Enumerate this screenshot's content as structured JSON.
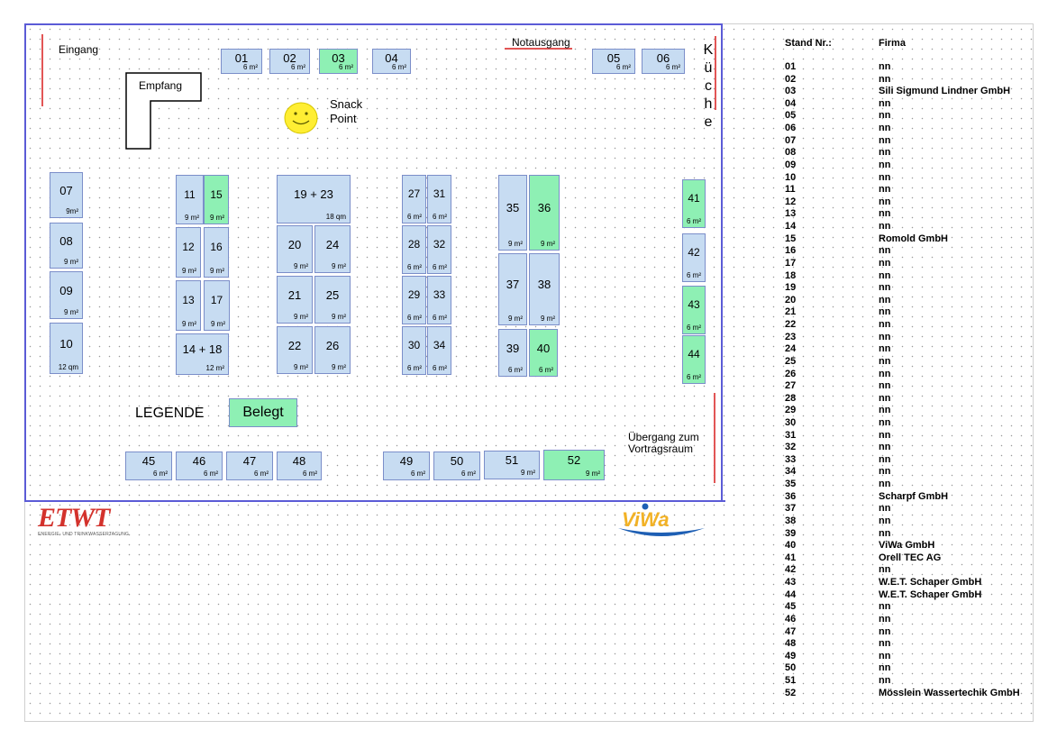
{
  "labels": {
    "entrance": "Eingang",
    "reception": "Empfang",
    "emergency_exit": "Notausgang",
    "snack_line1": "Snack",
    "snack_line2": "Point",
    "kitchen_letters": [
      "K",
      "ü",
      "c",
      "h",
      "e"
    ],
    "legend": "LEGENDE",
    "legend_occupied": "Belegt",
    "transition_line1": "Übergang zum",
    "transition_line2": "Vortragsraum"
  },
  "colors": {
    "stand_free": "#c7dcf2",
    "stand_occupied": "#8ef0b4",
    "hall_border": "#5b5bd6",
    "exit_line": "#e25555"
  },
  "stands": [
    {
      "num": "01",
      "area": "6 m²",
      "occupied": false
    },
    {
      "num": "02",
      "area": "6 m²",
      "occupied": false
    },
    {
      "num": "03",
      "area": "6 m²",
      "occupied": true
    },
    {
      "num": "04",
      "area": "6 m²",
      "occupied": false
    },
    {
      "num": "05",
      "area": "6 m²",
      "occupied": false
    },
    {
      "num": "06",
      "area": "6 m²",
      "occupied": false
    },
    {
      "num": "07",
      "area": "9m²",
      "occupied": false
    },
    {
      "num": "08",
      "area": "9 m²",
      "occupied": false
    },
    {
      "num": "09",
      "area": "9 m²",
      "occupied": false
    },
    {
      "num": "10",
      "area": "12 qm",
      "occupied": false
    },
    {
      "num": "11",
      "area": "9 m²",
      "occupied": false
    },
    {
      "num": "15",
      "area": "9 m²",
      "occupied": true
    },
    {
      "num": "12",
      "area": "9 m²",
      "occupied": false
    },
    {
      "num": "16",
      "area": "9 m²",
      "occupied": false
    },
    {
      "num": "13",
      "area": "9 m²",
      "occupied": false
    },
    {
      "num": "17",
      "area": "9 m²",
      "occupied": false
    },
    {
      "num": "14 + 18",
      "area": "12 m²",
      "occupied": false
    },
    {
      "num": "19  +  23",
      "area": "18 qm",
      "occupied": false
    },
    {
      "num": "20",
      "area": "9 m²",
      "occupied": false
    },
    {
      "num": "24",
      "area": "9 m²",
      "occupied": false
    },
    {
      "num": "21",
      "area": "9 m²",
      "occupied": false
    },
    {
      "num": "25",
      "area": "9 m²",
      "occupied": false
    },
    {
      "num": "22",
      "area": "9 m²",
      "occupied": false
    },
    {
      "num": "26",
      "area": "9 m²",
      "occupied": false
    },
    {
      "num": "27",
      "area": "6 m²",
      "occupied": false
    },
    {
      "num": "31",
      "area": "6 m²",
      "occupied": false
    },
    {
      "num": "28",
      "area": "6 m²",
      "occupied": false
    },
    {
      "num": "32",
      "area": "6 m²",
      "occupied": false
    },
    {
      "num": "29",
      "area": "6 m²",
      "occupied": false
    },
    {
      "num": "33",
      "area": "6 m²",
      "occupied": false
    },
    {
      "num": "30",
      "area": "6 m²",
      "occupied": false
    },
    {
      "num": "34",
      "area": "6 m²",
      "occupied": false
    },
    {
      "num": "35",
      "area": "9 m²",
      "occupied": false
    },
    {
      "num": "36",
      "area": "9 m²",
      "occupied": true
    },
    {
      "num": "37",
      "area": "9 m²",
      "occupied": false
    },
    {
      "num": "38",
      "area": "9 m²",
      "occupied": false
    },
    {
      "num": "39",
      "area": "6 m²",
      "occupied": false
    },
    {
      "num": "40",
      "area": "6 m²",
      "occupied": true
    },
    {
      "num": "41",
      "area": "6 m²",
      "occupied": true
    },
    {
      "num": "42",
      "area": "6 m²",
      "occupied": false
    },
    {
      "num": "43",
      "area": "6 m²",
      "occupied": true
    },
    {
      "num": "44",
      "area": "6 m²",
      "occupied": true
    },
    {
      "num": "45",
      "area": "6 m²",
      "occupied": false
    },
    {
      "num": "46",
      "area": "6 m²",
      "occupied": false
    },
    {
      "num": "47",
      "area": "6 m²",
      "occupied": false
    },
    {
      "num": "48",
      "area": "6 m²",
      "occupied": false
    },
    {
      "num": "49",
      "area": "6 m²",
      "occupied": false
    },
    {
      "num": "50",
      "area": "6 m²",
      "occupied": false
    },
    {
      "num": "51",
      "area": "9 m²",
      "occupied": false
    },
    {
      "num": "52",
      "area": "9 m²",
      "occupied": true
    }
  ],
  "list": {
    "header_stand": "Stand Nr.:",
    "header_company": "Firma",
    "rows": [
      [
        "01",
        "nn"
      ],
      [
        "02",
        "nn"
      ],
      [
        "03",
        "Sili Sigmund Lindner GmbH"
      ],
      [
        "04",
        "nn"
      ],
      [
        "05",
        "nn"
      ],
      [
        "06",
        "nn"
      ],
      [
        "07",
        "nn"
      ],
      [
        "08",
        "nn"
      ],
      [
        "09",
        "nn"
      ],
      [
        "10",
        "nn"
      ],
      [
        "11",
        "nn"
      ],
      [
        "12",
        "nn"
      ],
      [
        "13",
        "nn"
      ],
      [
        "14",
        "nn"
      ],
      [
        "15",
        "Romold GmbH"
      ],
      [
        "16",
        "nn"
      ],
      [
        "17",
        "nn"
      ],
      [
        "18",
        "nn"
      ],
      [
        "19",
        "nn"
      ],
      [
        "20",
        "nn"
      ],
      [
        "21",
        "nn"
      ],
      [
        "22",
        "nn"
      ],
      [
        "23",
        "nn"
      ],
      [
        "24",
        "nn"
      ],
      [
        "25",
        "nn"
      ],
      [
        "26",
        "nn"
      ],
      [
        "27",
        "nn"
      ],
      [
        "28",
        "nn"
      ],
      [
        "29",
        "nn"
      ],
      [
        "30",
        "nn"
      ],
      [
        "31",
        "nn"
      ],
      [
        "32",
        "nn"
      ],
      [
        "33",
        "nn"
      ],
      [
        "34",
        "nn"
      ],
      [
        "35",
        "nn"
      ],
      [
        "36",
        "Scharpf GmbH"
      ],
      [
        "37",
        "nn"
      ],
      [
        "38",
        "nn"
      ],
      [
        "39",
        "nn"
      ],
      [
        "40",
        "ViWa GmbH"
      ],
      [
        "41",
        "Orell TEC AG"
      ],
      [
        "42",
        "nn"
      ],
      [
        "43",
        "W.E.T. Schaper GmbH"
      ],
      [
        "44",
        "W.E.T. Schaper GmbH"
      ],
      [
        "45",
        "nn"
      ],
      [
        "46",
        "nn"
      ],
      [
        "47",
        "nn"
      ],
      [
        "48",
        "nn"
      ],
      [
        "49",
        "nn"
      ],
      [
        "50",
        "nn"
      ],
      [
        "51",
        "nn"
      ],
      [
        "52",
        "Mösslein Wassertechik GmbH"
      ]
    ]
  },
  "logos": {
    "etwt_text": "ETWT",
    "etwt_subtitle": "ENERGIE- UND TRINKWASSERTAGUNG",
    "viwa_text": "ViWa"
  }
}
